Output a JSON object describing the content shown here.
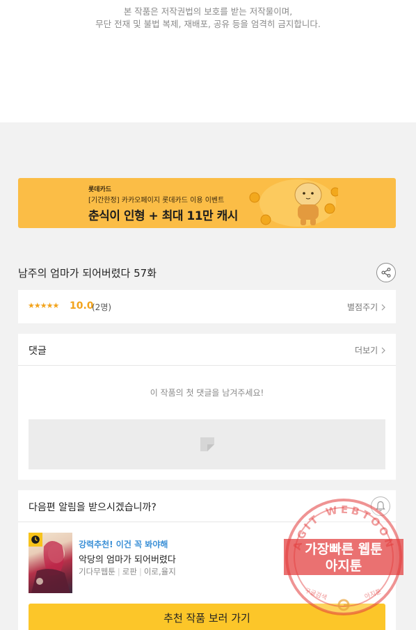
{
  "copyright": {
    "line1": "본 작품은 저작권법의 보호를 받는 저작물이며,",
    "line2": "무단 전재 및 불법 복제, 재배포, 공유 등을 엄격히 금지합니다."
  },
  "banner": {
    "brand": "롯데카드",
    "subtitle": "[기간한정] 카카오페이지 롯데카드 이용 이벤트",
    "headline": "춘식이 인형 + 최대 11만 캐시"
  },
  "episode": {
    "title": "남주의 엄마가 되어버렸다 57화"
  },
  "rating": {
    "stars": "★★★★★",
    "score": "10.0",
    "count": "(2명)",
    "rate_link": "별점주기"
  },
  "comments": {
    "title": "댓글",
    "more": "더보기",
    "empty_message": "이 작품의 첫 댓글을 남겨주세요!"
  },
  "notify": {
    "question": "다음편 알림을 받으시겠습니까?",
    "tag": "강력추천! 이건 꼭 봐야해",
    "rec_title": "악당의 엄마가 되어버렸다",
    "meta": [
      "기다무웹툰",
      "로판",
      "이로,율지"
    ],
    "button": "추천 작품 보러 가기"
  },
  "watermark": {
    "ring_text": "AGIT WEBTOON",
    "line1": "가장빠른 웹툰",
    "line2": "아지툰",
    "small_left": "구글검색",
    "small_right": "아지툰"
  },
  "icons": {
    "share": "share-icon",
    "bell": "bell-icon",
    "clock": "clock-icon",
    "chevron": "chevron-right-icon"
  },
  "colors": {
    "accent_yellow": "#fcc629",
    "banner_yellow": "#fbbd46",
    "star_orange": "#f2a31b",
    "tag_blue": "#3a8fd6",
    "stamp_red": "#e23a3a"
  }
}
